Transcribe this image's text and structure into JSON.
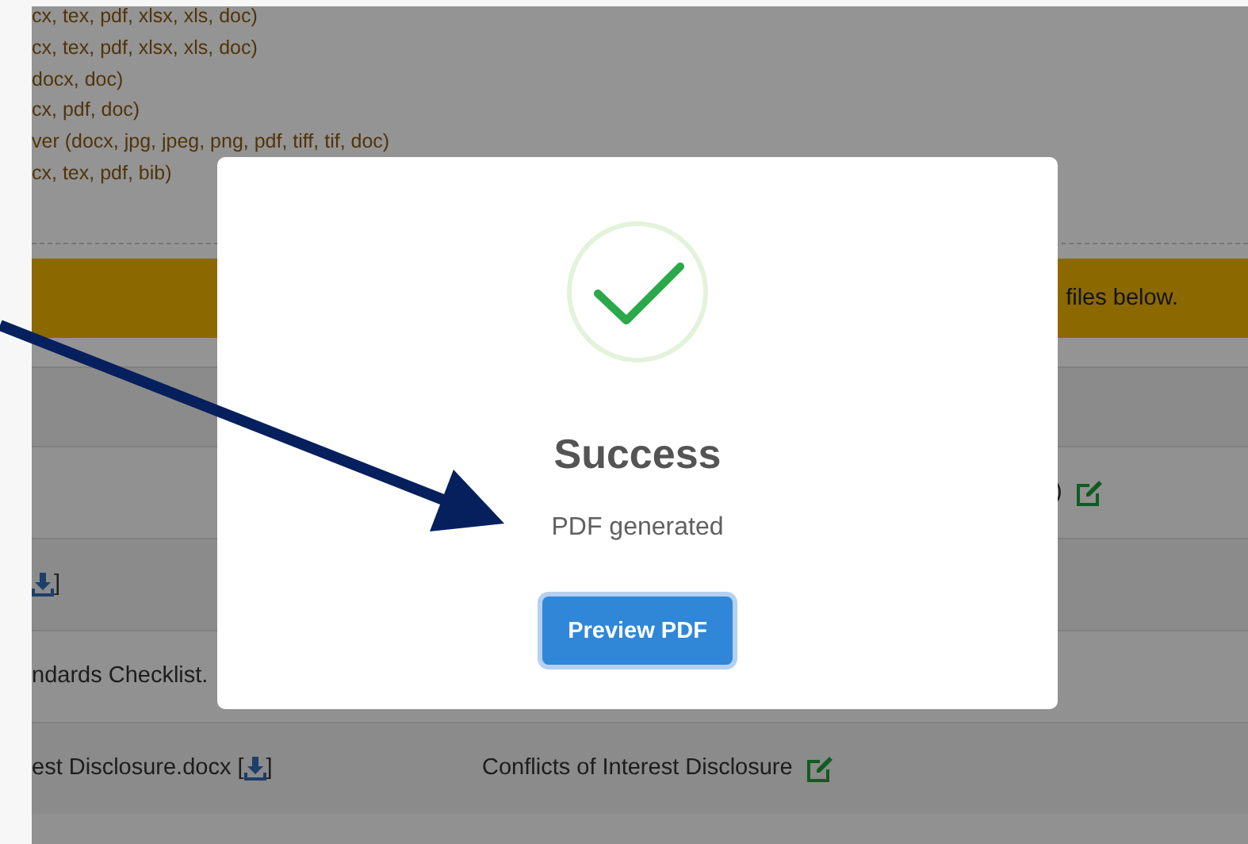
{
  "file_types": [
    "cx, tex, pdf, xlsx, xls, doc)",
    "cx, tex, pdf, xlsx, xls, doc)",
    "docx, doc)",
    "cx, pdf, doc)",
    "ver (docx, jpg, jpeg, png, pdf, tiff, tif, doc)",
    "cx, tex, pdf, bib)"
  ],
  "banner": {
    "text": "files below."
  },
  "table": {
    "rows": [
      {
        "column_3": ")",
        "edit": true
      },
      {
        "download": true,
        "file_suffix": "]"
      },
      {
        "file": "ndards Checklist."
      },
      {
        "file": "est Disclosure.docx [",
        "download": true,
        "file_suffix": "]",
        "title": "Conflicts of Interest Disclosure",
        "edit": true
      }
    ]
  },
  "modal": {
    "open": true,
    "title": "Success",
    "message": "PDF generated",
    "button": "Preview PDF"
  }
}
